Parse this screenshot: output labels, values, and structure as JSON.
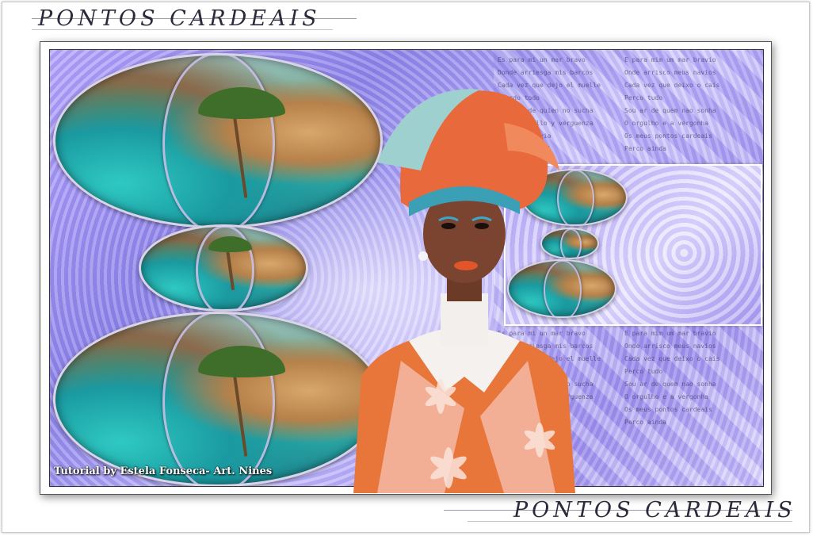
{
  "header": {
    "title": "PONTOS CARDEAIS"
  },
  "footer": {
    "title": "PONTOS CARDEAIS"
  },
  "artwork": {
    "credit": "Tutorial by Estela Fonseca- Art. Nines"
  },
  "lyrics": [
    "Es para mi un mar bravo",
    "Donde arriesga mis barcos",
    "Cada vez que dejo el muelle",
    "Pierdo todo",
    "Es aire de quien no sucha",
    "Es el orgullo y verguenza",
    "Pierdo todavia",
    "Es el cardinal"
  ],
  "lyrics_right": [
    "E para mim um mar bravio",
    "Onde arrisco meus navios",
    "Cada vez que deixo o cais",
    "Perco tudo",
    "Sou ar de quem nao sonha",
    "O orgulho e a vergonha",
    "Os meus pontos cardeais",
    "Perco ainda"
  ],
  "colors": {
    "accent": "#9b8ff0",
    "title_text": "#2a2a3a",
    "frame": "#ffffff"
  }
}
